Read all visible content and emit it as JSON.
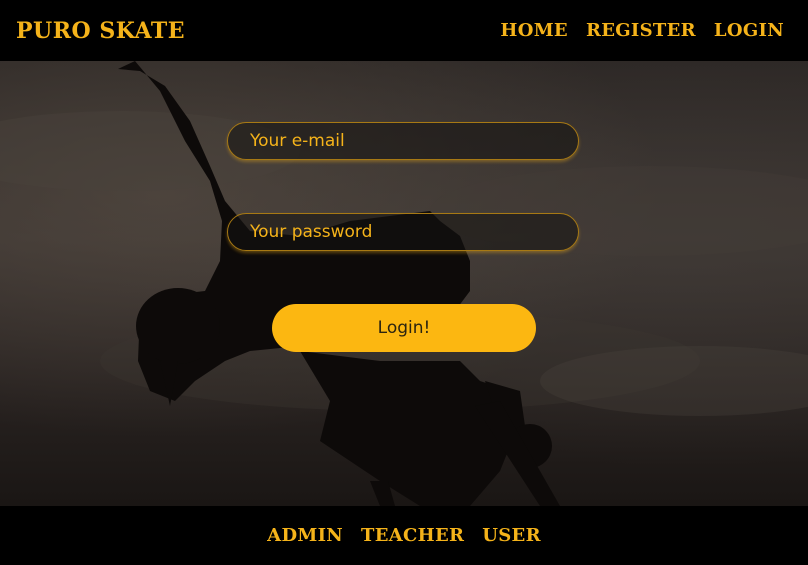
{
  "header": {
    "brand": "PURO SKATE",
    "nav": [
      {
        "label": "HOME"
      },
      {
        "label": "REGISTER"
      },
      {
        "label": "LOGIN"
      }
    ]
  },
  "form": {
    "email_placeholder": "Your e-mail",
    "email_value": "",
    "password_placeholder": "Your password",
    "password_value": "",
    "submit_label": "Login!"
  },
  "footer": {
    "links": [
      {
        "label": "ADMIN"
      },
      {
        "label": "TEACHER"
      },
      {
        "label": "USER"
      }
    ]
  },
  "colors": {
    "accent": "#f5b31a",
    "button": "#fcb711",
    "bar_background": "#000000"
  }
}
